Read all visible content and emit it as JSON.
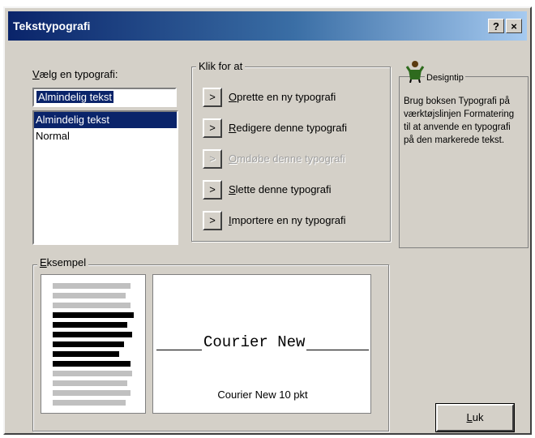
{
  "window": {
    "title": "Teksttypografi",
    "help_button": "?",
    "close_button": "×"
  },
  "style_selector": {
    "label_accel": "V",
    "label_rest": "ælg en typografi:",
    "input_value": "Almindelig tekst",
    "items": [
      {
        "label": "Almindelig tekst",
        "selected": true
      },
      {
        "label": "Normal",
        "selected": false
      }
    ]
  },
  "actions": {
    "group_label": "Klik for at",
    "button_symbol": ">",
    "items": [
      {
        "accel": "O",
        "rest": "prette en ny typografi",
        "enabled": true
      },
      {
        "accel": "R",
        "rest": "edigere denne typografi",
        "enabled": true
      },
      {
        "accel": "O",
        "rest": "mdøbe denne typografi",
        "enabled": false
      },
      {
        "accel": "S",
        "rest": "lette denne typografi",
        "enabled": true
      },
      {
        "accel": "I",
        "rest": "mportere en ny typografi",
        "enabled": true
      }
    ]
  },
  "design_tip": {
    "heading": "Designtip",
    "icon": "designer-figure-icon",
    "body": "Brug boksen Typografi på værktøjslinjen Formatering til at anvende en typografi på den markerede tekst."
  },
  "example": {
    "group_label_accel": "E",
    "group_label_rest": "ksempel",
    "font_sample": "Courier New",
    "font_caption": "Courier New 10 pkt"
  },
  "close_button": {
    "accel": "L",
    "rest": "uk"
  }
}
